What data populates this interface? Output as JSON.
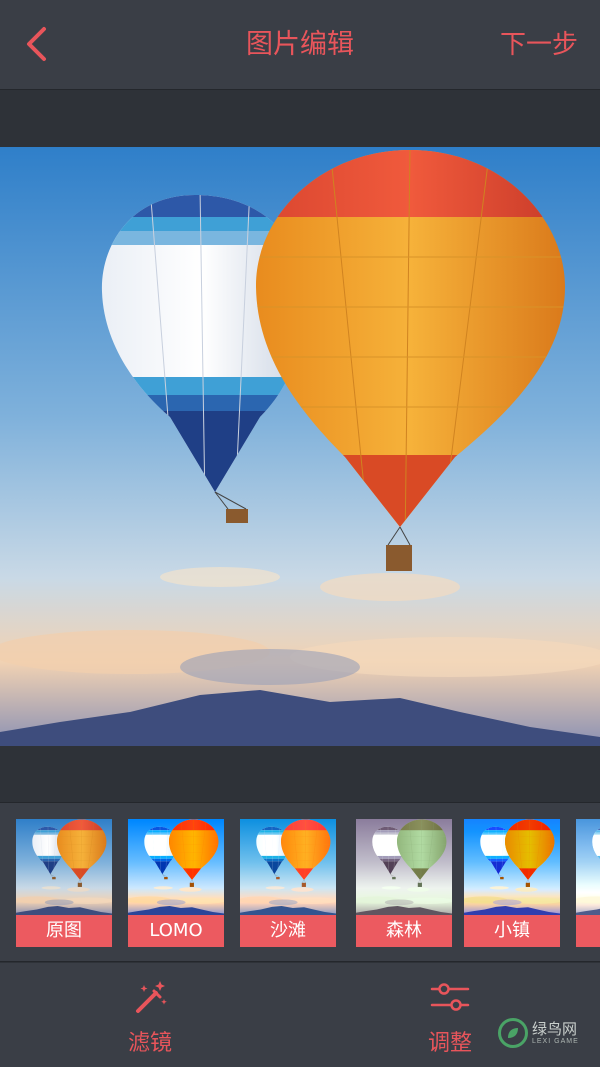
{
  "header": {
    "title": "图片编辑",
    "next_label": "下一步"
  },
  "icons": {
    "back": "chevron-left-icon",
    "filter": "magic-wand-icon",
    "adjust": "sliders-icon"
  },
  "colors": {
    "accent": "#e8555b",
    "label_bg": "#ec5a60",
    "bar_bg": "#3a3e46",
    "page_bg": "#2e3238"
  },
  "filters": [
    {
      "label": "原图",
      "variant": "original"
    },
    {
      "label": "LOMO",
      "variant": "lomo"
    },
    {
      "label": "沙滩",
      "variant": "beach"
    },
    {
      "label": "森林",
      "variant": "forest"
    },
    {
      "label": "小镇",
      "variant": "town"
    }
  ],
  "bottom_bar": {
    "filter_label": "滤镜",
    "adjust_label": "调整"
  },
  "watermark": {
    "main": "绿鸟网",
    "sub": "LEXI GAME"
  }
}
